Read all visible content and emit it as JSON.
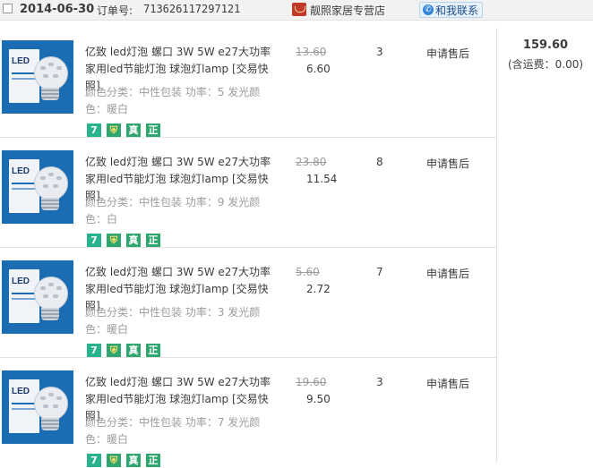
{
  "order": {
    "date": "2014-06-30",
    "order_no_label": "订单号:",
    "order_no": "713626117297121",
    "shop_icon": "tmall-shop-icon",
    "shop_name": "靓照家居专营店",
    "contact_label": "和我联系",
    "total": "159.60",
    "shipping": "(含运费：0.00)"
  },
  "items": [
    {
      "title": "亿致 led灯泡 螺口 3W 5W e27大功率家用led节能灯泡 球泡灯lamp [交易快照]",
      "props": "颜色分类：中性包装 功率：5 发光颜色：暖白",
      "orig_price": "13.60",
      "price": "6.60",
      "qty": "3",
      "after_sale": "申请售后"
    },
    {
      "title": "亿致 led灯泡 螺口 3W 5W e27大功率家用led节能灯泡 球泡灯lamp [交易快照]",
      "props": "颜色分类：中性包装 功率：9 发光颜色：白",
      "orig_price": "23.80",
      "price": "11.54",
      "qty": "8",
      "after_sale": "申请售后"
    },
    {
      "title": "亿致 led灯泡 螺口 3W 5W e27大功率家用led节能灯泡 球泡灯lamp [交易快照]",
      "props": "颜色分类：中性包装 功率：3 发光颜色：暖白",
      "orig_price": "5.60",
      "price": "2.72",
      "qty": "7",
      "after_sale": "申请售后"
    },
    {
      "title": "亿致 led灯泡 螺口 3W 5W e27大功率家用led节能灯泡 球泡灯lamp [交易快照]",
      "props": "颜色分类：中性包装 功率：7 发光颜色：暖白",
      "orig_price": "19.60",
      "price": "9.50",
      "qty": "3",
      "after_sale": "申请售后"
    }
  ],
  "badges": {
    "seven": "7",
    "zhen": "真",
    "zheng": "正"
  },
  "thumb": {
    "brand": "LED"
  },
  "colors": {
    "header_bg": "#f2f2f2",
    "border": "#e3e3e3",
    "badge_green": "#2fa66e",
    "thumb_blue": "#1a6cb3"
  }
}
